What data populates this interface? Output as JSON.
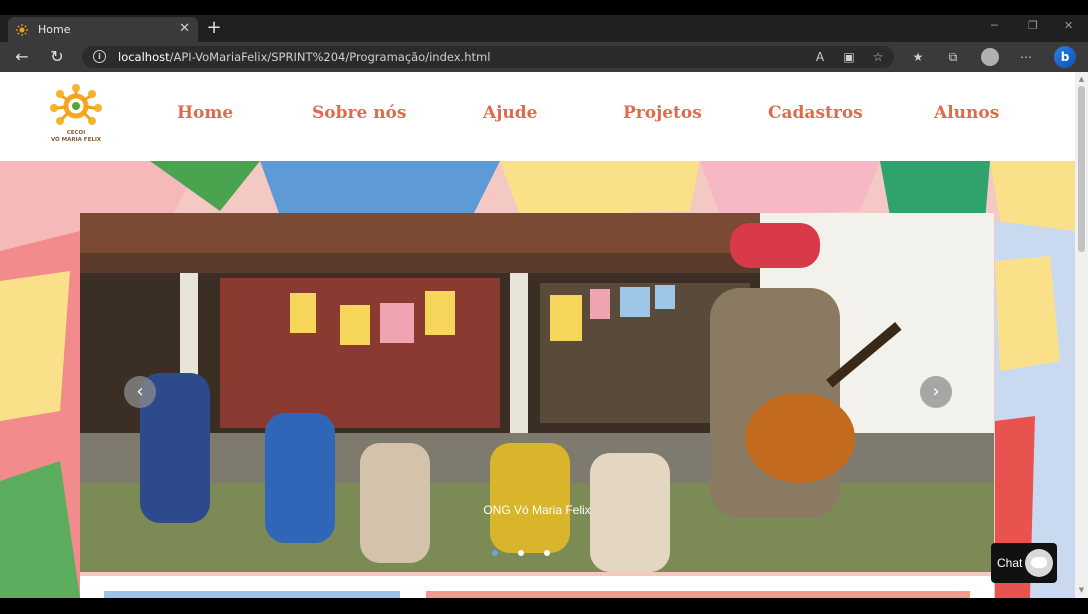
{
  "browser": {
    "tab_title": "Home",
    "tab_close": "✕",
    "new_tab": "+",
    "url_host": "localhost",
    "url_path": "/API-VoMariaFelix/SPRINT%204/Programação/index.html"
  },
  "site": {
    "logo_text_line1": "CECOI",
    "logo_text_line2": "VÓ MARIA FELIX",
    "nav": [
      "Home",
      "Sobre nós",
      "Ajude",
      "Projetos",
      "Cadastros",
      "Alunos"
    ]
  },
  "carousel": {
    "caption": "ONG Vó Maria Felix",
    "prev": "‹",
    "next": "›",
    "slides": 3,
    "active_slide": 1
  },
  "chat": {
    "label": "Chat"
  },
  "colors": {
    "nav": "#e06a4e",
    "chrome_dark": "#202020",
    "chrome_bar": "#3a3a3a"
  }
}
